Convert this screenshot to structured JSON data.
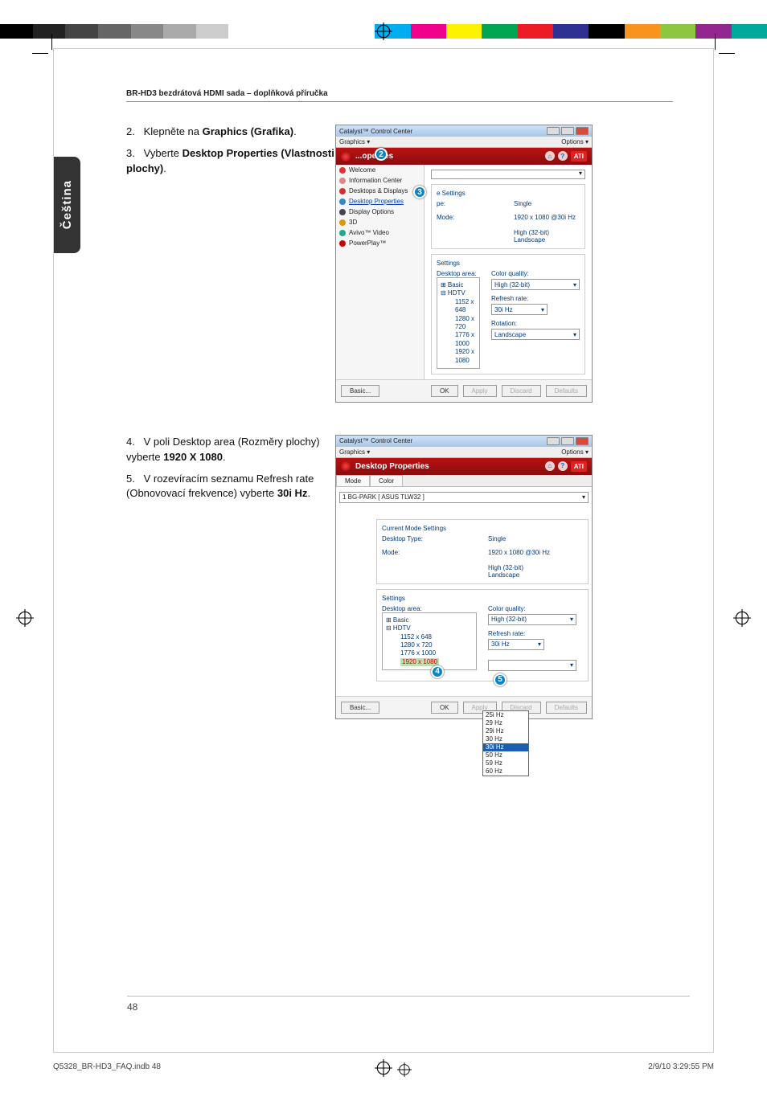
{
  "running_head": "BR-HD3 bezdrátová HDMI sada – doplňková příručka",
  "side_tab": "Čeština",
  "page_number": "48",
  "steps": {
    "s2_num": "2.",
    "s2_pre": "Klepněte na ",
    "s2_bold": "Graphics (Grafika)",
    "s2_post": ".",
    "s3_num": "3.",
    "s3_pre": "Vyberte ",
    "s3_bold": "Desktop Properties (Vlastnosti plochy)",
    "s3_post": ".",
    "s4_num": "4.",
    "s4_text_a": "V poli Desktop area (Rozměry plochy) vyberte ",
    "s4_bold": "1920 X 1080",
    "s4_post": ".",
    "s5_num": "5.",
    "s5_text_a": "V rozevíracím seznamu Refresh rate (Obnovovací frekvence) vyberte ",
    "s5_bold": "30i Hz",
    "s5_post": "."
  },
  "win1": {
    "title": "Catalyst™ Control Center",
    "menubar_left": "Graphics ▾",
    "menubar_right": "Options ▾",
    "red_header": "...operties",
    "sidebar": [
      "Welcome",
      "Information Center",
      "Desktops & Displays",
      "Desktop Properties",
      "Display Options",
      "3D",
      "Avivo™ Video",
      "PowerPlay™"
    ],
    "sidebar_selected_index": 3,
    "sidebar_icon_colors": [
      "#d33",
      "#d88",
      "#c33",
      "#38c",
      "#445",
      "#d90",
      "#2a8",
      "#c00"
    ],
    "current_mode_label": "e Settings",
    "desktop_type_label": "pe:",
    "desktop_type_value": "Single",
    "mode_label": "Mode:",
    "mode_value": "1920 x 1080 @30i Hz",
    "color_value": "High (32-bit)",
    "orient_value": "Landscape",
    "settings_label": "Settings",
    "desktop_area_label": "Desktop area:",
    "tree": {
      "basic": "⊞ Basic",
      "hdtv": "⊟ HDTV",
      "items": [
        "1152 x 648",
        "1280 x 720",
        "1776 x 1000",
        "1920 x 1080"
      ]
    },
    "cq_label": "Color quality:",
    "cq_value": "High (32-bit)",
    "rr_label": "Refresh rate:",
    "rr_value": "30i Hz",
    "rot_label": "Rotation:",
    "rot_value": "Landscape",
    "buttons": [
      "Basic...",
      "OK",
      "Apply",
      "Discard",
      "Defaults"
    ]
  },
  "win2": {
    "title": "Catalyst™ Control Center",
    "menubar_left": "Graphics ▾",
    "menubar_right": "Options ▾",
    "red_header": "Desktop Properties",
    "tabs": [
      "Mode",
      "Color"
    ],
    "display_selector": "1 BG-PARK [ ASUS TLW32 ]",
    "current_mode_label": "Current Mode Settings",
    "desktop_type_label": "Desktop Type:",
    "desktop_type_value": "Single",
    "mode_label": "Mode:",
    "mode_value": "1920 x 1080 @30i Hz",
    "color_value": "High (32-bit)",
    "orient_value": "Landscape",
    "settings_label": "Settings",
    "desktop_area_label": "Desktop area:",
    "tree": {
      "basic": "⊞ Basic",
      "hdtv": "⊟ HDTV",
      "items": [
        "1152 x 648",
        "1280 x 720",
        "1776 x 1000",
        "1920 x 1080"
      ],
      "selected": "1920 x 1080"
    },
    "cq_label": "Color quality:",
    "cq_value": "High (32-bit)",
    "rr_label": "Refresh rate:",
    "rr_value": "30i Hz",
    "refresh_options": [
      "25i Hz",
      "29 Hz",
      "29i Hz",
      "30 Hz",
      "30i Hz",
      "50 Hz",
      "59 Hz",
      "60 Hz"
    ],
    "refresh_sel": "30i Hz",
    "buttons": [
      "Basic...",
      "OK",
      "Apply",
      "Discard",
      "Defaults"
    ]
  },
  "callouts": {
    "c2": "2",
    "c3": "3",
    "c4": "4",
    "c5": "5"
  },
  "colorbars_left": [
    "#000",
    "#222",
    "#444",
    "#666",
    "#888",
    "#aaa",
    "#ccc",
    "#fff",
    "#fff",
    "#fff"
  ],
  "colorbars_right": [
    "#fff",
    "#00aeef",
    "#ec008c",
    "#fff200",
    "#00a651",
    "#ed1c24",
    "#2e3192",
    "#000",
    "#f7941d",
    "#8dc63f",
    "#92278f",
    "#00a99d"
  ],
  "footer": {
    "left": "Q5328_BR-HD3_FAQ.indb   48",
    "right": "2/9/10   3:29:55 PM"
  }
}
